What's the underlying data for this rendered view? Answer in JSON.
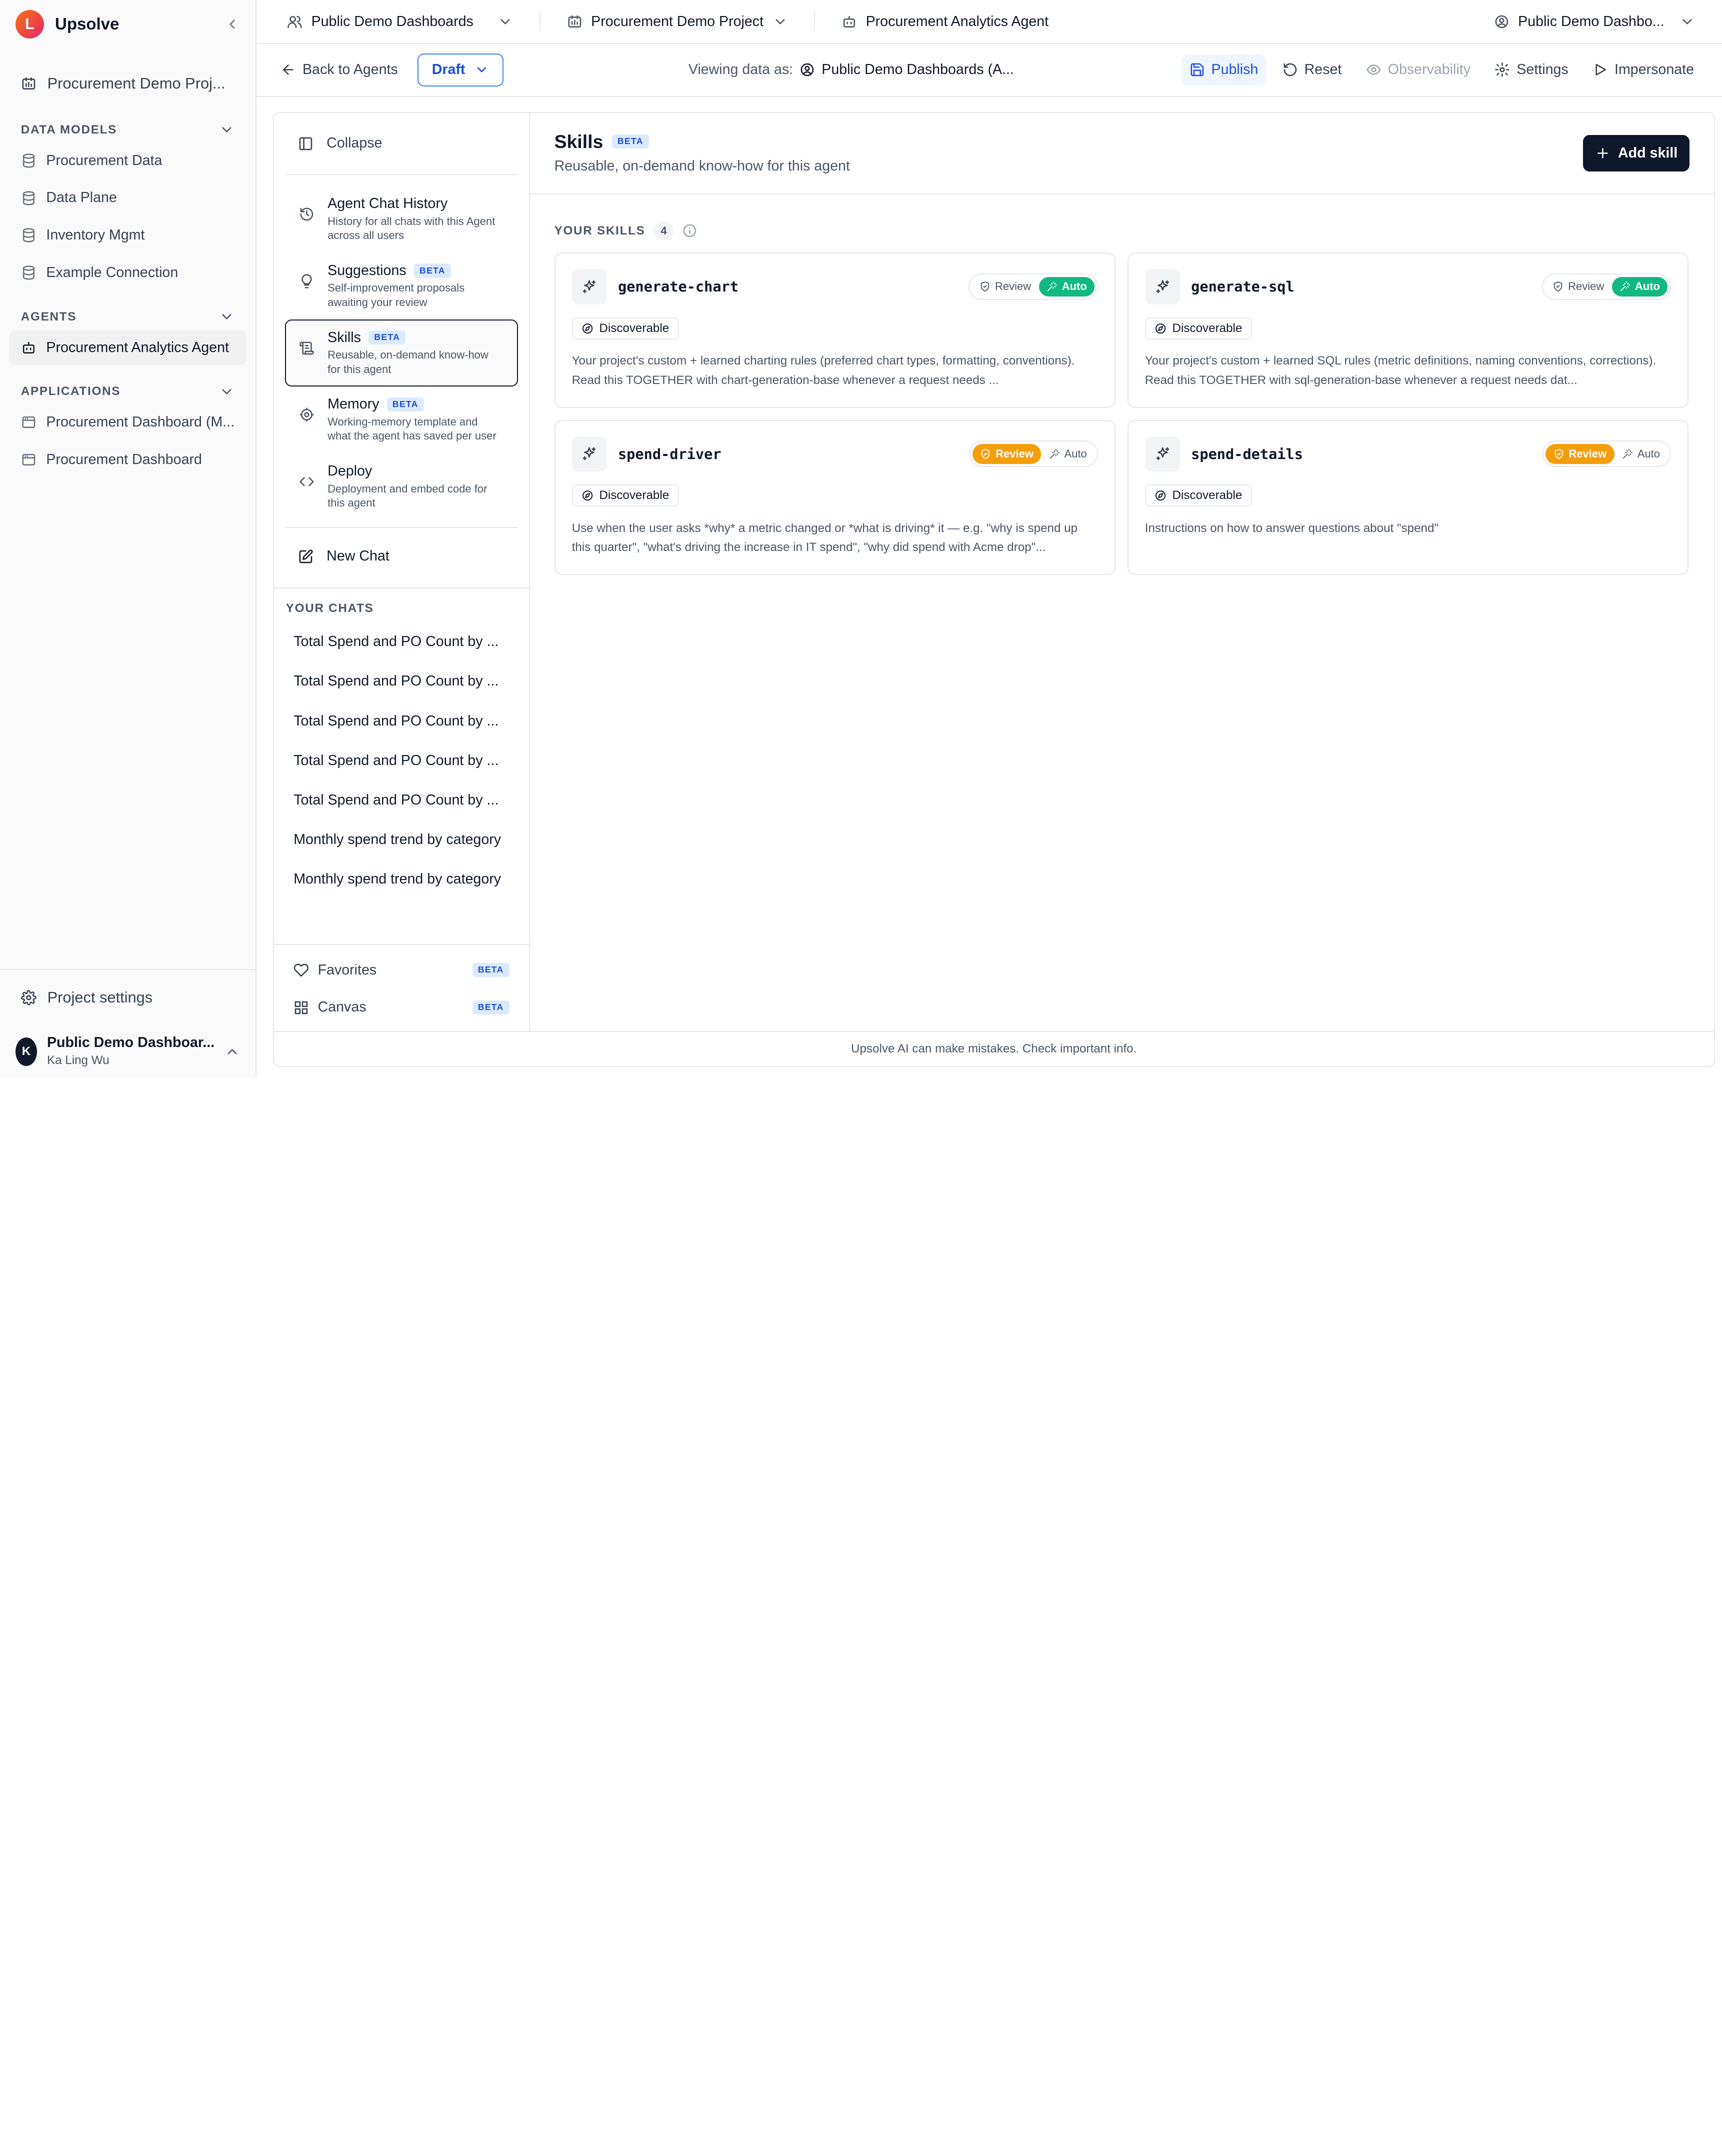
{
  "brand": {
    "logo_letter": "L",
    "name": "Upsolve"
  },
  "sidebar": {
    "project": "Procurement Demo Proj...",
    "sections": {
      "data_models": "DATA MODELS",
      "agents": "AGENTS",
      "applications": "APPLICATIONS"
    },
    "data_models": [
      "Procurement Data",
      "Data Plane",
      "Inventory Mgmt",
      "Example Connection"
    ],
    "agents": [
      "Procurement Analytics Agent"
    ],
    "applications": [
      "Procurement Dashboard (M...",
      "Procurement Dashboard"
    ],
    "project_settings": "Project settings",
    "user": {
      "initial": "K",
      "name": "Public Demo Dashboar...",
      "sub": "Ka Ling Wu"
    }
  },
  "topbar": {
    "org": "Public Demo Dashboards",
    "project": "Procurement Demo Project",
    "agent": "Procurement Analytics Agent",
    "account": "Public Demo Dashbo..."
  },
  "toolbar": {
    "back": "Back to Agents",
    "status": "Draft",
    "viewing_label": "Viewing data as:",
    "viewing_value": "Public Demo Dashboards (A...",
    "publish": "Publish",
    "reset": "Reset",
    "observability": "Observability",
    "settings": "Settings",
    "impersonate": "Impersonate"
  },
  "agent_nav": {
    "collapse": "Collapse",
    "items": [
      {
        "title": "Agent Chat History",
        "desc": "History for all chats with this Agent across all users",
        "beta": false,
        "active": false
      },
      {
        "title": "Suggestions",
        "desc": "Self-improvement proposals awaiting your review",
        "beta": true,
        "active": false
      },
      {
        "title": "Skills",
        "desc": "Reusable, on-demand know-how for this agent",
        "beta": true,
        "active": true
      },
      {
        "title": "Memory",
        "desc": "Working-memory template and what the agent has saved per user",
        "beta": true,
        "active": false
      },
      {
        "title": "Deploy",
        "desc": "Deployment and embed code for this agent",
        "beta": false,
        "active": false
      }
    ],
    "beta_label": "BETA",
    "new_chat": "New Chat",
    "your_chats": "YOUR CHATS",
    "chats": [
      "Total Spend and PO Count by ...",
      "Total Spend and PO Count by ...",
      "Total Spend and PO Count by ...",
      "Total Spend and PO Count by ...",
      "Total Spend and PO Count by ...",
      "Monthly spend trend by category",
      "Monthly spend trend by category"
    ],
    "favorites": "Favorites",
    "canvas": "Canvas"
  },
  "skills": {
    "title": "Skills",
    "beta": "BETA",
    "subtitle": "Reusable, on-demand know-how for this agent",
    "add": "Add skill",
    "section": "YOUR SKILLS",
    "count": "4",
    "review_label": "Review",
    "auto_label": "Auto",
    "discoverable_label": "Discoverable",
    "cards": [
      {
        "name": "generate-chart",
        "mode": "auto",
        "desc": "Your project's custom + learned charting rules (preferred chart types, formatting, conventions). Read this TOGETHER with chart-generation-base whenever a request needs ..."
      },
      {
        "name": "generate-sql",
        "mode": "auto",
        "desc": "Your project's custom + learned SQL rules (metric definitions, naming conventions, corrections). Read this TOGETHER with sql-generation-base whenever a request needs dat..."
      },
      {
        "name": "spend-driver",
        "mode": "review",
        "desc": "Use when the user asks *why* a metric changed or *what is driving* it — e.g. \"why is spend up this quarter\", \"what's driving the increase in IT spend\", \"why did spend with Acme drop\"..."
      },
      {
        "name": "spend-details",
        "mode": "review",
        "desc": "Instructions on how to answer questions about \"spend\""
      }
    ]
  },
  "footer": "Upsolve AI can make mistakes. Check important info.",
  "colors": {
    "accent": "#1d4ed8",
    "auto_green": "#10b981",
    "review_orange": "#f59e0b",
    "primary_button": "#0f172a"
  }
}
